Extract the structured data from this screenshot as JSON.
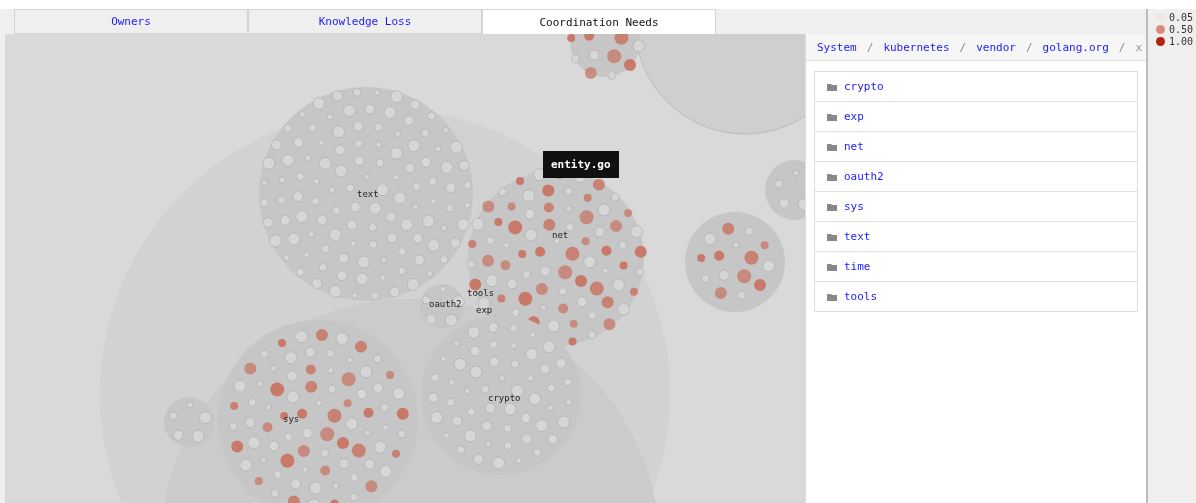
{
  "tabs": [
    {
      "label": "Owners",
      "selected": false
    },
    {
      "label": "Knowledge Loss",
      "selected": false
    },
    {
      "label": "Coordination Needs",
      "selected": true
    }
  ],
  "canvas": {
    "labels": [
      "text",
      "net",
      "oauth2",
      "tools",
      "exp",
      "crypto",
      "sys"
    ],
    "tooltip": "entity.go"
  },
  "breadcrumb": {
    "items": [
      "System",
      "kubernetes",
      "vendor",
      "golang.org"
    ],
    "separator": "/",
    "close": "x"
  },
  "folders": [
    "crypto",
    "exp",
    "net",
    "oauth2",
    "sys",
    "text",
    "time",
    "tools"
  ],
  "legend": [
    {
      "label": "0.05",
      "color": "#f0e6e4"
    },
    {
      "label": "0.50",
      "color": "#d98a7a"
    },
    {
      "label": "1.00",
      "color": "#b2220f"
    }
  ]
}
